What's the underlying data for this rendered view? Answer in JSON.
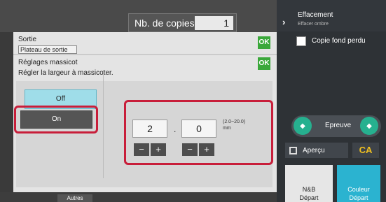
{
  "header": {
    "copies_label": "Nb. de copies",
    "copies_value": "1"
  },
  "right_panel": {
    "title": "Effacement",
    "subtitle": "Effacer ombre",
    "checkbox_label": "Copie fond perdu",
    "preview_label": "Epreuve",
    "apercu_label": "Aperçu",
    "ca_label": "CA",
    "bw_start": {
      "line1": "N&B",
      "line2": "Départ"
    },
    "color_start": {
      "line1": "Couleur",
      "line2": "Départ"
    }
  },
  "dialog": {
    "output_title": "Sortie",
    "output_value": "Plateau de sortie",
    "ok_label": "OK",
    "trim_title": "Réglages massicot",
    "trim_desc": "Régler la largeur à massicoter.",
    "off_label": "Off",
    "on_label": "On",
    "int_value": "2",
    "dec_value": "0",
    "separator": ".",
    "range_line1": "(2.0~20.0)",
    "range_line2": "mm",
    "minus": "−",
    "plus": "+"
  },
  "footer": {
    "autres_label": "Autres"
  },
  "colors": {
    "ok": "#3aa83a",
    "off_selected": "#9fdde9",
    "highlight": "#c81e3a",
    "color_start": "#2bb3d0"
  }
}
